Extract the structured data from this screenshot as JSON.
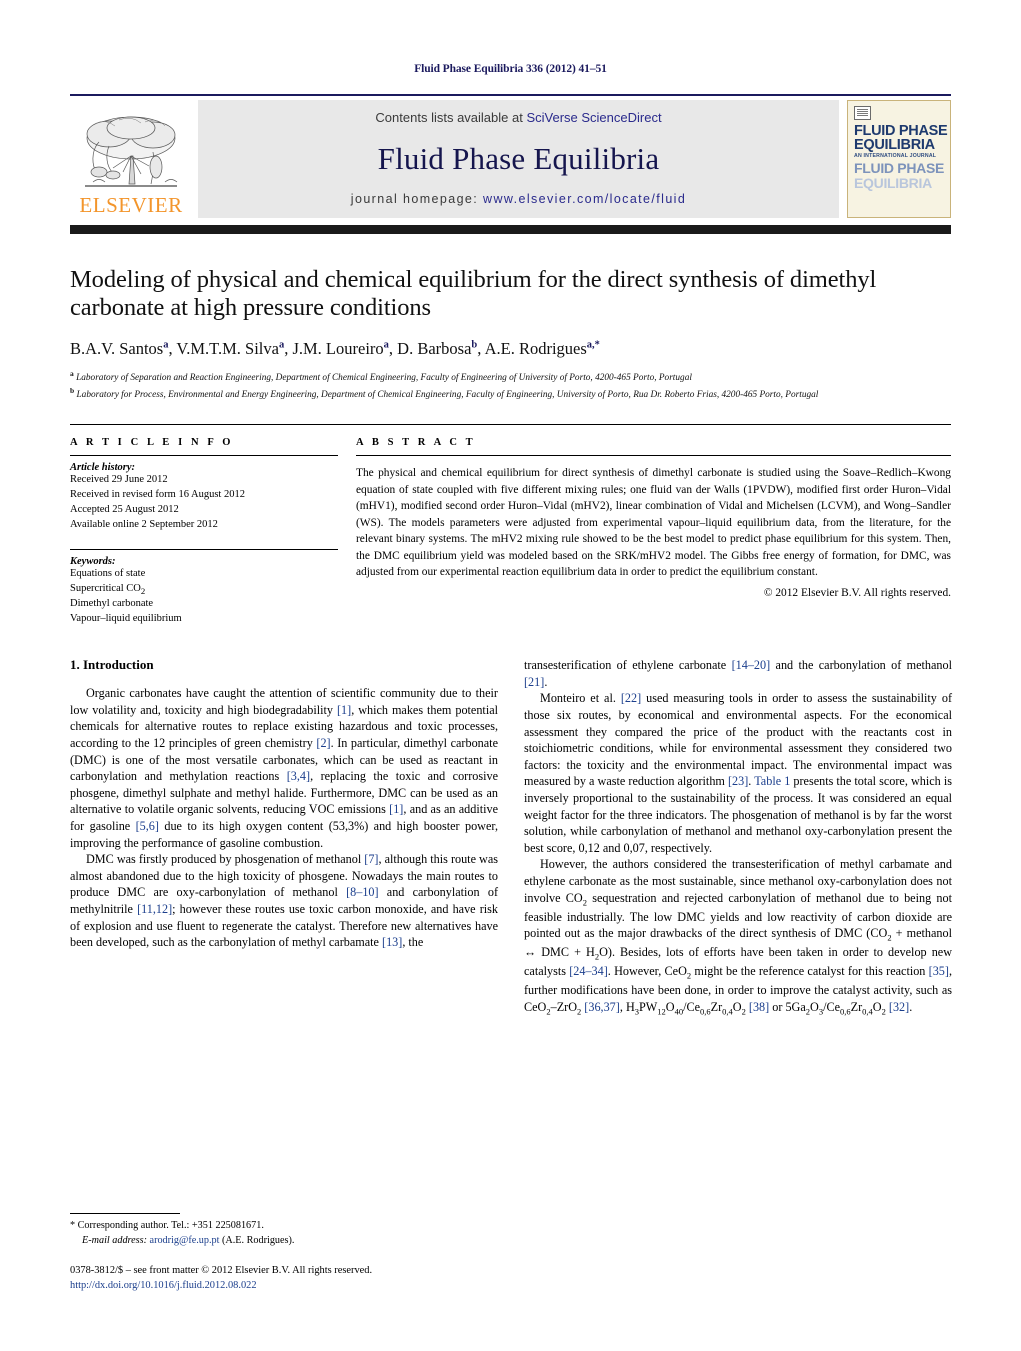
{
  "running_head": "Fluid Phase Equilibria 336 (2012) 41–51",
  "masthead": {
    "publisher_name": "ELSEVIER",
    "contents_prefix": "Contents lists available at ",
    "contents_link": "SciVerse ScienceDirect",
    "journal_title": "Fluid Phase Equilibria",
    "homepage_prefix": "journal homepage: ",
    "homepage_url": "www.elsevier.com/locate/fluid",
    "cover": {
      "line1": "FLUID PHASE",
      "line2": "EQUILIBRIA",
      "subtitle": "AN INTERNATIONAL JOURNAL",
      "line3": "FLUID PHASE",
      "line4": "EQUILIBRIA"
    }
  },
  "article": {
    "title": "Modeling of physical and chemical equilibrium for the direct synthesis of dimethyl carbonate at high pressure conditions",
    "authors_html": "B.A.V. Santos<sup>a</sup>, V.M.T.M. Silva<sup>a</sup>, J.M. Loureiro<sup>a</sup>, D. Barbosa<sup>b</sup>, A.E. Rodrigues<sup>a,*</sup>",
    "affiliation_a": "Laboratory of Separation and Reaction Engineering, Department of Chemical Engineering, Faculty of Engineering of University of Porto, 4200-465 Porto, Portugal",
    "affiliation_b": "Laboratory for Process, Environmental and Energy Engineering, Department of Chemical Engineering, Faculty of Engineering, University of Porto, Rua Dr. Roberto Frias, 4200-465 Porto, Portugal"
  },
  "article_info": {
    "heading": "A R T I C L E   I N F O",
    "history_label": "Article history:",
    "history": [
      "Received 29 June 2012",
      "Received in revised form 16 August 2012",
      "Accepted 25 August 2012",
      "Available online 2 September 2012"
    ],
    "keywords_label": "Keywords:",
    "keywords_html": [
      "Equations of state",
      "Supercritical CO<sub>2</sub>",
      "Dimethyl carbonate",
      "Vapour–liquid equilibrium"
    ]
  },
  "abstract": {
    "heading": "A B S T R A C T",
    "text": "The physical and chemical equilibrium for direct synthesis of dimethyl carbonate is studied using the Soave–Redlich–Kwong equation of state coupled with five different mixing rules; one fluid van der Walls (1PVDW), modified first order Huron–Vidal (mHV1), modified second order Huron–Vidal (mHV2), linear combination of Vidal and Michelsen (LCVM), and Wong–Sandler (WS). The models parameters were adjusted from experimental vapour–liquid equilibrium data, from the literature, for the relevant binary systems. The mHV2 mixing rule showed to be the best model to predict phase equilibrium for this system. Then, the DMC equilibrium yield was modeled based on the SRK/mHV2 model. The Gibbs free energy of formation, for DMC, was adjusted from our experimental reaction equilibrium data in order to predict the equilibrium constant.",
    "copyright": "© 2012 Elsevier B.V. All rights reserved."
  },
  "body": {
    "section_number_title": "1.  Introduction",
    "left_paragraphs_html": [
      "Organic carbonates have caught the attention of scientific community due to their low volatility and, toxicity and high biodegradability <span class=\"ref\">[1]</span>, which makes them potential chemicals for alternative routes to replace existing hazardous and toxic processes, according to the 12 principles of green chemistry <span class=\"ref\">[2]</span>. In particular, dimethyl carbonate (DMC) is one of the most versatile carbonates, which can be used as reactant in carbonylation and methylation reactions <span class=\"ref\">[3,4]</span>, replacing the toxic and corrosive phosgene, dimethyl sulphate and methyl halide. Furthermore, DMC can be used as an alternative to volatile organic solvents, reducing VOC emissions <span class=\"ref\">[1]</span>, and as an additive for gasoline <span class=\"ref\">[5,6]</span> due to its high oxygen content (53,3%) and high booster power, improving the performance of gasoline combustion.",
      "DMC was firstly produced by phosgenation of methanol <span class=\"ref\">[7]</span>, although this route was almost abandoned due to the high toxicity of phosgene. Nowadays the main routes to produce DMC are oxy-carbonylation of methanol <span class=\"ref\">[8–10]</span> and carbonylation of methylnitrile <span class=\"ref\">[11,12]</span>; however these routes use toxic carbon monoxide, and have risk of explosion and use fluent to regenerate the catalyst. Therefore new alternatives have been developed, such as the carbonylation of methyl carbamate <span class=\"ref\">[13]</span>, the"
    ],
    "right_paragraphs_html": [
      "transesterification of ethylene carbonate <span class=\"ref\">[14–20]</span> and the carbonylation of methanol <span class=\"ref\">[21]</span>.",
      "Monteiro et al. <span class=\"ref\">[22]</span> used measuring tools in order to assess the sustainability of those six routes, by economical and environmental aspects. For the economical assessment they compared the price of the product with the reactants cost in stoichiometric conditions, while for environmental assessment they considered two factors: the toxicity and the environmental impact. The environmental impact was measured by a waste reduction algorithm <span class=\"ref\">[23]</span>. <span class=\"ref\">Table 1</span> presents the total score, which is inversely proportional to the sustainability of the process. It was considered an equal weight factor for the three indicators. The phosgenation of methanol is by far the worst solution, while carbonylation of methanol and methanol oxy-carbonylation present the best score, 0,12 and 0,07, respectively.",
      "However, the authors considered the transesterification of methyl carbamate and ethylene carbonate as the most sustainable, since methanol oxy-carbonylation does not involve CO<sub>2</sub> sequestration and rejected carbonylation of methanol due to being not feasible industrially. The low DMC yields and low reactivity of carbon dioxide are pointed out as the major drawbacks of the direct synthesis of DMC (CO<sub>2</sub> + methanol ↔ DMC + H<sub>2</sub>O). Besides, lots of efforts have been taken in order to develop new catalysts <span class=\"ref\">[24–34]</span>. However, CeO<sub>2</sub> might be the reference catalyst for this reaction <span class=\"ref\">[35]</span>, further modifications have been done, in order to improve the catalyst activity, such as CeO<sub>2</sub>–ZrO<sub>2</sub> <span class=\"ref\">[36,37]</span>, H<sub>3</sub>PW<sub>12</sub>O<sub>40</sub>/Ce<sub>0,6</sub>Zr<sub>0,4</sub>O<sub>2</sub> <span class=\"ref\">[38]</span> or 5Ga<sub>2</sub>O<sub>3</sub>/Ce<sub>0,6</sub>Zr<sub>0,4</sub>O<sub>2</sub> <span class=\"ref\">[32]</span>."
    ]
  },
  "footer": {
    "corresponding_html": "<span class=\"star\">*</span> Corresponding author. Tel.: +351 225081671.",
    "email_html": "<span class=\"em-lbl\">E-mail address:</span> <span class=\"fn-mail\">arodrig@fe.up.pt</span> (A.E. Rodrigues).",
    "issn_line": "0378-3812/$ – see front matter © 2012 Elsevier B.V. All rights reserved.",
    "doi": "http://dx.doi.org/10.1016/j.fluid.2012.08.022"
  }
}
